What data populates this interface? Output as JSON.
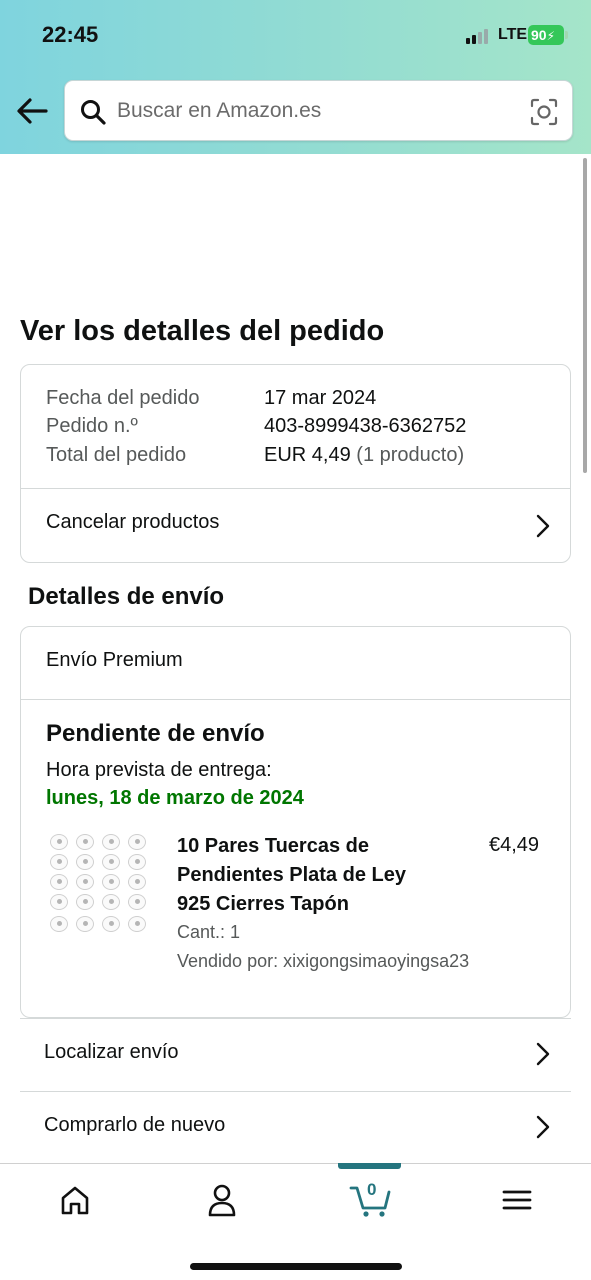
{
  "status_bar": {
    "time": "22:45",
    "network": "LTE",
    "battery": "90"
  },
  "search": {
    "placeholder": "Buscar en Amazon.es"
  },
  "page_title": "Ver los detalles del pedido",
  "order_info": {
    "date_label": "Fecha del pedido",
    "date_value": "17 mar 2024",
    "number_label": "Pedido n.º",
    "number_value": "403-8999438-6362752",
    "total_label": "Total del pedido",
    "total_value": "EUR 4,49",
    "total_count": "(1 producto)",
    "cancel_label": "Cancelar productos"
  },
  "shipping": {
    "section_title": "Detalles de envío",
    "type": "Envío Premium",
    "status": "Pendiente de envío",
    "eta_label": "Hora prevista de entrega:",
    "eta_date": "lunes, 18 de marzo de 2024",
    "product": {
      "title": "10 Pares Tuercas de Pendientes Plata de Ley 925 Cierres Tapón",
      "price": "€4,49",
      "quantity": "Cant.: 1",
      "seller": "Vendido por: xixigongsimaoyingsa23"
    }
  },
  "actions": {
    "track_label": "Localizar envío",
    "buy_again_label": "Comprarlo de nuevo"
  },
  "tabbar": {
    "cart_count": "0",
    "active_tab": "cart",
    "accent_color": "#25757f"
  }
}
